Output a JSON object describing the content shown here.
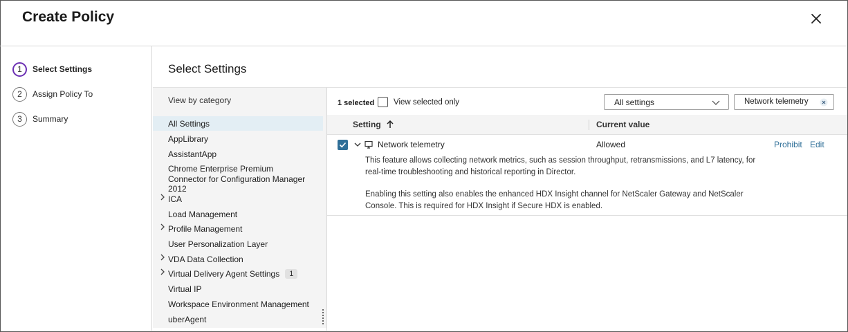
{
  "header": {
    "title": "Create Policy"
  },
  "wizard": {
    "steps": [
      {
        "number": "1",
        "label": "Select Settings",
        "active": true
      },
      {
        "number": "2",
        "label": "Assign Policy To",
        "active": false
      },
      {
        "number": "3",
        "label": "Summary",
        "active": false
      }
    ]
  },
  "section_title": "Select Settings",
  "categories": {
    "view_by_label": "View by category",
    "items": [
      {
        "label": "All Settings",
        "selected": true,
        "expandable": false,
        "count": ""
      },
      {
        "label": "AppLibrary",
        "selected": false,
        "expandable": false,
        "count": ""
      },
      {
        "label": "AssistantApp",
        "selected": false,
        "expandable": false,
        "count": ""
      },
      {
        "label": "Chrome Enterprise Premium",
        "selected": false,
        "expandable": false,
        "count": ""
      },
      {
        "label": "Connector for Configuration Manager 2012",
        "selected": false,
        "expandable": false,
        "count": ""
      },
      {
        "label": "ICA",
        "selected": false,
        "expandable": true,
        "count": ""
      },
      {
        "label": "Load Management",
        "selected": false,
        "expandable": false,
        "count": ""
      },
      {
        "label": "Profile Management",
        "selected": false,
        "expandable": true,
        "count": ""
      },
      {
        "label": "User Personalization Layer",
        "selected": false,
        "expandable": false,
        "count": ""
      },
      {
        "label": "VDA Data Collection",
        "selected": false,
        "expandable": true,
        "count": ""
      },
      {
        "label": "Virtual Delivery Agent Settings",
        "selected": false,
        "expandable": true,
        "count": "1"
      },
      {
        "label": "Virtual IP",
        "selected": false,
        "expandable": false,
        "count": ""
      },
      {
        "label": "Workspace Environment Management",
        "selected": false,
        "expandable": false,
        "count": ""
      },
      {
        "label": "uberAgent",
        "selected": false,
        "expandable": false,
        "count": ""
      }
    ]
  },
  "toolbar": {
    "selected_count": "1 selected",
    "view_selected_only": "View selected only",
    "view_selected_only_checked": false,
    "filter_dropdown": "All settings",
    "search_chip": "Network telemetry"
  },
  "table": {
    "columns": {
      "setting": "Setting",
      "current_value": "Current value"
    },
    "rows": [
      {
        "checked": true,
        "name": "Network telemetry",
        "value": "Allowed",
        "actions": {
          "prohibit": "Prohibit",
          "edit": "Edit"
        },
        "description_1": "This feature allows collecting network metrics, such as session throughput, retransmissions, and L7 latency, for real-time troubleshooting and historical reporting in Director.",
        "description_2": "Enabling this setting also enables the enhanced HDX Insight channel for NetScaler Gateway and NetScaler Console. This is required for HDX Insight if Secure HDX is enabled."
      }
    ]
  },
  "colors": {
    "accent": "#2f6f98",
    "step_active": "#6b2fb3",
    "selected_bg": "#e3eef4"
  },
  "icons": [
    "close-icon",
    "chevron-down-icon",
    "sort-ascending-icon",
    "monitor-icon",
    "clear-icon",
    "chevron-right-icon",
    "more-vertical-icon"
  ]
}
